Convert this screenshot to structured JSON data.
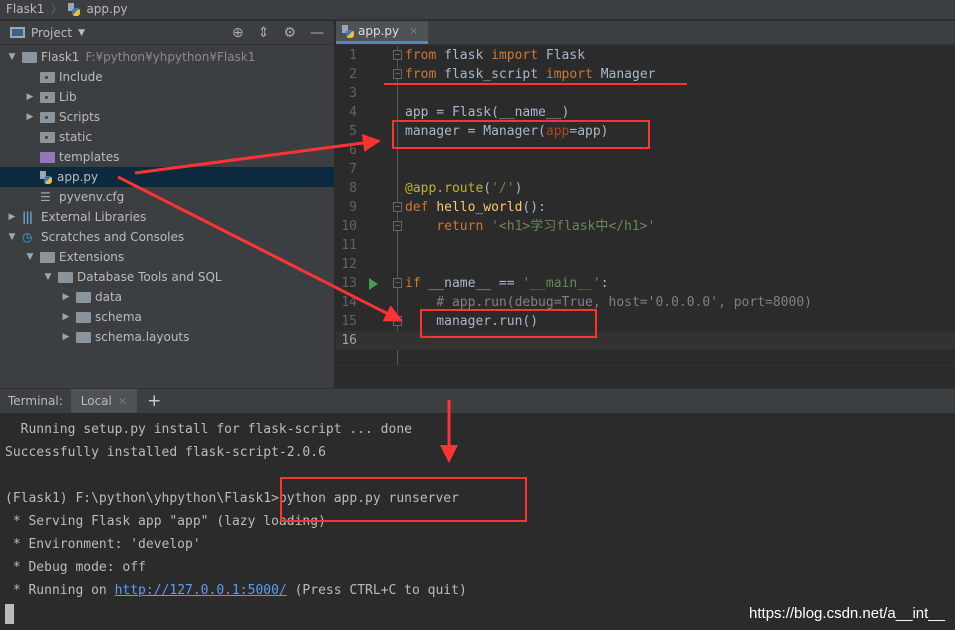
{
  "breadcrumb": [
    "Flask1",
    "app.py"
  ],
  "project_panel": {
    "title": "Project",
    "tools": [
      "locate-icon",
      "collapse-icon",
      "gear-icon",
      "minimize-icon"
    ],
    "tree": [
      {
        "label": "Flask1",
        "path": "F:¥python¥yhpython¥Flask1",
        "level": 0,
        "arrow": "down",
        "icon": "folder"
      },
      {
        "label": "Include",
        "level": 1,
        "arrow": "",
        "icon": "src"
      },
      {
        "label": "Lib",
        "level": 1,
        "arrow": "right",
        "icon": "src"
      },
      {
        "label": "Scripts",
        "level": 1,
        "arrow": "right",
        "icon": "src"
      },
      {
        "label": "static",
        "level": 1,
        "arrow": "",
        "icon": "src"
      },
      {
        "label": "templates",
        "level": 1,
        "arrow": "",
        "icon": "purple"
      },
      {
        "label": "app.py",
        "level": 1,
        "arrow": "",
        "icon": "py",
        "selected": true
      },
      {
        "label": "pyvenv.cfg",
        "level": 1,
        "arrow": "",
        "icon": "cfg"
      },
      {
        "label": "External Libraries",
        "level": 0,
        "arrow": "right",
        "icon": "lib"
      },
      {
        "label": "Scratches and Consoles",
        "level": 0,
        "arrow": "down",
        "icon": "scratch"
      },
      {
        "label": "Extensions",
        "level": 1,
        "arrow": "down",
        "icon": "folder"
      },
      {
        "label": "Database Tools and SQL",
        "level": 2,
        "arrow": "down",
        "icon": "folder"
      },
      {
        "label": "data",
        "level": 3,
        "arrow": "right",
        "icon": "folder"
      },
      {
        "label": "schema",
        "level": 3,
        "arrow": "right",
        "icon": "folder"
      },
      {
        "label": "schema.layouts",
        "level": 3,
        "arrow": "right",
        "icon": "folder"
      }
    ]
  },
  "editor": {
    "tab": "app.py",
    "current_line": 16,
    "lines": [
      [
        [
          "kw",
          "from "
        ],
        [
          "df",
          "flask "
        ],
        [
          "kw",
          "import "
        ],
        [
          "df",
          "Flask"
        ]
      ],
      [
        [
          "kw",
          "from "
        ],
        [
          "df",
          "flask_script "
        ],
        [
          "kw",
          "import "
        ],
        [
          "df",
          "Manager"
        ]
      ],
      [],
      [
        [
          "df",
          "app = Flask(__name__)"
        ]
      ],
      [
        [
          "df",
          "manager = Manager("
        ],
        [
          "pr",
          "app"
        ],
        [
          "df",
          "=app)"
        ]
      ],
      [],
      [],
      [
        [
          "dc",
          "@app.route"
        ],
        [
          "df",
          "("
        ],
        [
          "st",
          "'/'"
        ],
        [
          "df",
          ")"
        ]
      ],
      [
        [
          "kw",
          "def "
        ],
        [
          "fn",
          "hello_world"
        ],
        [
          "df",
          "():"
        ]
      ],
      [
        [
          "df",
          "    "
        ],
        [
          "kw",
          "return "
        ],
        [
          "st",
          "'<h1>学习flask中</h1>'"
        ]
      ],
      [],
      [],
      [
        [
          "kw",
          "if "
        ],
        [
          "df",
          "__name__ == "
        ],
        [
          "st",
          "'__main__'"
        ],
        [
          "df",
          ":"
        ]
      ],
      [
        [
          "cm",
          "    # app.run(debug=True, host='0.0.0.0', port=8000)"
        ]
      ],
      [
        [
          "df",
          "    manager.run()"
        ]
      ],
      []
    ]
  },
  "terminal": {
    "label": "Terminal:",
    "tab": "Local",
    "lines": [
      "  Running setup.py install for flask-script ... done",
      "Successfully installed flask-script-2.0.6",
      "",
      "(Flask1) F:\\python\\yhpython\\Flask1>python app.py runserver",
      " * Serving Flask app \"app\" (lazy loading)",
      " * Environment: 'develop'",
      " * Debug mode: off"
    ],
    "running_prefix": " * Running on ",
    "url": "http://127.0.0.1:5000/",
    "running_suffix": " (Press CTRL+C to quit)"
  },
  "watermark": "https://blog.csdn.net/a__int__",
  "colors": {
    "annotation": "#ff3333",
    "keyword": "#cc7832",
    "string": "#6a8759",
    "link": "#589df6"
  }
}
